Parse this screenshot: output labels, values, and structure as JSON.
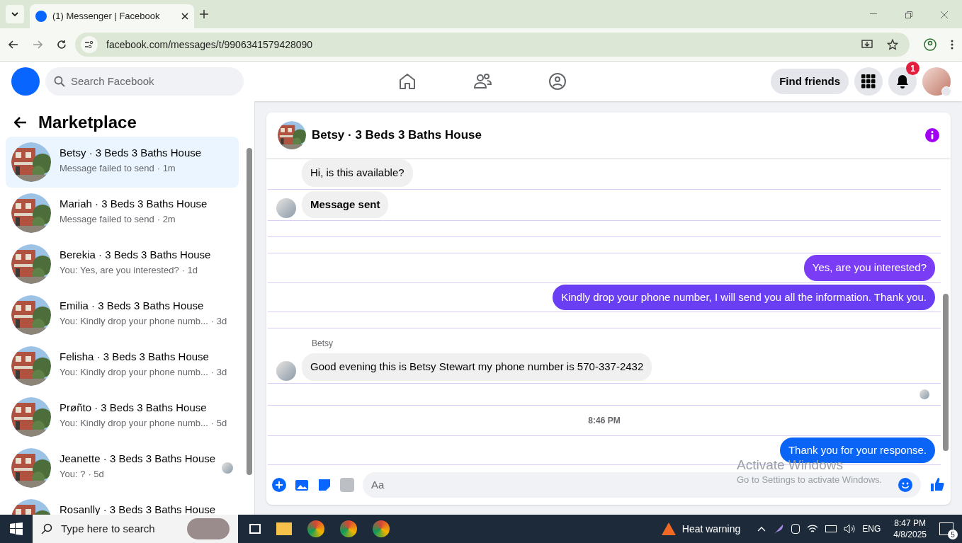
{
  "browser": {
    "tab_title": "(1) Messenger | Facebook",
    "url": "facebook.com/messages/t/9906341579428090"
  },
  "header": {
    "search_placeholder": "Search Facebook",
    "find_friends": "Find friends",
    "notification_count": "1"
  },
  "sidebar": {
    "title": "Marketplace",
    "conversations": [
      {
        "name": "Betsy · 3 Beds 3 Baths House",
        "preview": "Message failed to send",
        "time": "· 1m",
        "selected": true,
        "seen": false
      },
      {
        "name": "Mariah · 3 Beds 3 Baths House",
        "preview": "Message failed to send",
        "time": "· 2m",
        "selected": false,
        "seen": false
      },
      {
        "name": "Berekia · 3 Beds 3 Baths House",
        "preview": "You: Yes, are you interested?",
        "time": "· 1d",
        "selected": false,
        "seen": false
      },
      {
        "name": "Emilia · 3 Beds 3 Baths House",
        "preview": "You: Kindly drop your phone numb...",
        "time": "· 3d",
        "selected": false,
        "seen": false
      },
      {
        "name": "Felisha · 3 Beds 3 Baths House",
        "preview": "You: Kindly drop your phone numb...",
        "time": "· 3d",
        "selected": false,
        "seen": false
      },
      {
        "name": "Prøñto · 3 Beds 3 Baths House",
        "preview": "You: Kindly drop your phone numb...",
        "time": "· 5d",
        "selected": false,
        "seen": false
      },
      {
        "name": "Jeanette · 3 Beds 3 Baths House",
        "preview": "You: ?",
        "time": "· 5d",
        "selected": false,
        "seen": true
      },
      {
        "name": "Rosanlly · 3 Beds 3 Baths House",
        "selected": false,
        "seen": false
      }
    ]
  },
  "chat": {
    "title": "Betsy · 3 Beds 3 Baths House",
    "messages": [
      {
        "kind": "incoming",
        "text": "Hi, is this available?",
        "avatar": false,
        "bold": false
      },
      {
        "kind": "incoming",
        "text": "Message sent",
        "avatar": true,
        "bold": true
      },
      {
        "kind": "spacer"
      },
      {
        "kind": "spacer"
      },
      {
        "kind": "outgoing",
        "text": "Yes, are you interested?",
        "color": "#7b3cf5"
      },
      {
        "kind": "outgoing",
        "text": "Kindly drop your phone number, I will send you all the information. Thank you.",
        "color": "#6a3ff4"
      },
      {
        "kind": "spacer"
      },
      {
        "kind": "sender",
        "text": "Betsy"
      },
      {
        "kind": "incoming",
        "text": "Good evening this is Betsy Stewart my phone number is 570-337-2432",
        "avatar": true,
        "bold": false
      },
      {
        "kind": "seen"
      },
      {
        "kind": "timestamp",
        "text": "8:46 PM"
      },
      {
        "kind": "outgoing",
        "text": "Thank you for your response.",
        "color": "#0a64f5"
      }
    ],
    "input_placeholder": "Aa"
  },
  "overlay": {
    "title": "Activate Windows",
    "subtitle": "Go to Settings to activate Windows."
  },
  "taskbar": {
    "search_placeholder": "Type here to search",
    "weather": "Heat warning",
    "language": "ENG",
    "time": "8:47 PM",
    "date": "4/8/2025",
    "notifications": "5"
  }
}
